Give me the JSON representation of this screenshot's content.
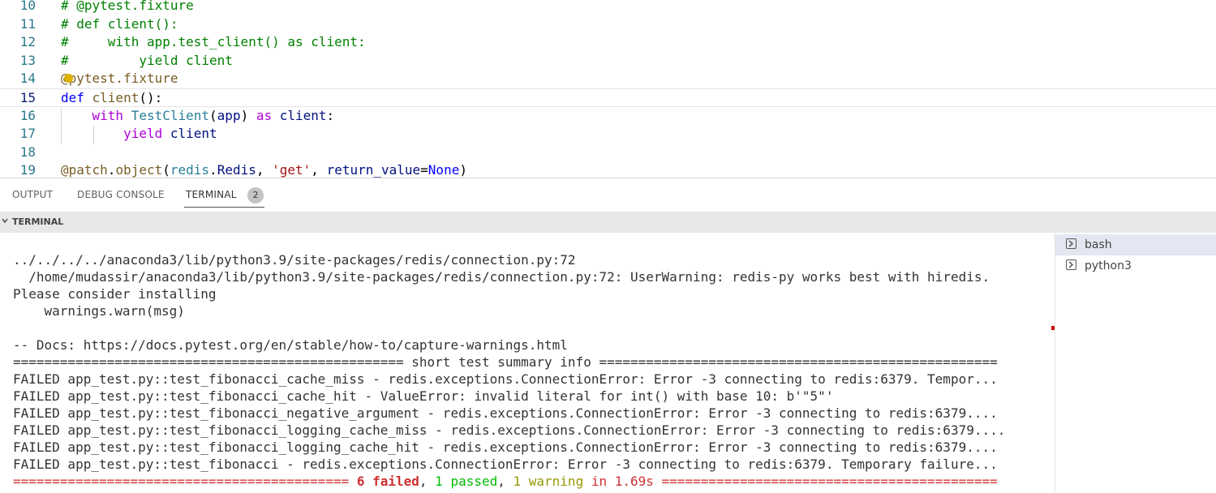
{
  "editor": {
    "lines": [
      {
        "num": "10",
        "tokens": [
          {
            "t": "# @pytest.fixture",
            "c": "cm"
          }
        ]
      },
      {
        "num": "11",
        "tokens": [
          {
            "t": "# def client():",
            "c": "cm"
          }
        ]
      },
      {
        "num": "12",
        "tokens": [
          {
            "t": "#     with app.test_client() as client:",
            "c": "cm"
          }
        ]
      },
      {
        "num": "13",
        "tokens": [
          {
            "t": "#         yield client",
            "c": "cm"
          }
        ]
      },
      {
        "num": "14",
        "tokens": [
          {
            "t": "@pytest.fixture",
            "c": "dec"
          }
        ]
      },
      {
        "num": "15",
        "tokens": [
          {
            "t": "def ",
            "c": "kw"
          },
          {
            "t": "client",
            "c": "fn"
          },
          {
            "t": "():",
            "c": ""
          }
        ]
      },
      {
        "num": "16",
        "tokens": [
          {
            "t": "    ",
            "c": ""
          },
          {
            "t": "with ",
            "c": "ctl"
          },
          {
            "t": "TestClient",
            "c": "cls"
          },
          {
            "t": "(",
            "c": ""
          },
          {
            "t": "app",
            "c": "var"
          },
          {
            "t": ") ",
            "c": ""
          },
          {
            "t": "as ",
            "c": "ctl"
          },
          {
            "t": "client",
            "c": "var"
          },
          {
            "t": ":",
            "c": ""
          }
        ]
      },
      {
        "num": "17",
        "tokens": [
          {
            "t": "        ",
            "c": ""
          },
          {
            "t": "yield ",
            "c": "ctl"
          },
          {
            "t": "client",
            "c": "var"
          }
        ]
      },
      {
        "num": "18",
        "tokens": []
      },
      {
        "num": "19",
        "tokens": [
          {
            "t": "@patch",
            "c": "dec"
          },
          {
            "t": ".",
            "c": ""
          },
          {
            "t": "object",
            "c": "fn"
          },
          {
            "t": "(",
            "c": ""
          },
          {
            "t": "redis",
            "c": "cls"
          },
          {
            "t": ".",
            "c": ""
          },
          {
            "t": "Redis",
            "c": "var"
          },
          {
            "t": ", ",
            "c": ""
          },
          {
            "t": "'get'",
            "c": "str"
          },
          {
            "t": ", ",
            "c": ""
          },
          {
            "t": "return_value",
            "c": "var"
          },
          {
            "t": "=",
            "c": ""
          },
          {
            "t": "None",
            "c": "kw"
          },
          {
            "t": ")",
            "c": ""
          }
        ]
      }
    ]
  },
  "panel": {
    "tabs": [
      {
        "label": "OUTPUT",
        "active": false
      },
      {
        "label": "DEBUG CONSOLE",
        "active": false
      },
      {
        "label": "TERMINAL",
        "active": true
      }
    ],
    "terminal_badge": "2",
    "section_title": "TERMINAL",
    "chevron_icon": "chevron-down-icon"
  },
  "terminal": {
    "lines": [
      [
        {
          "t": "../../../../anaconda3/lib/python3.9/site-packages/redis/connection.py:72",
          "c": ""
        }
      ],
      [
        {
          "t": "  /home/mudassir/anaconda3/lib/python3.9/site-packages/redis/connection.py:72: UserWarning: redis-py works best with hiredis.",
          "c": ""
        }
      ],
      [
        {
          "t": "Please consider installing",
          "c": ""
        }
      ],
      [
        {
          "t": "    warnings.warn(msg)",
          "c": ""
        }
      ],
      [],
      [
        {
          "t": "-- Docs: https://docs.pytest.org/en/stable/how-to/capture-warnings.html",
          "c": ""
        }
      ],
      [
        {
          "t": "================================================== short test summary info ===================================================",
          "c": ""
        }
      ],
      [
        {
          "t": "FAILED app_test.py::test_fibonacci_cache_miss - redis.exceptions.ConnectionError: Error -3 connecting to redis:6379. Tempor...",
          "c": ""
        }
      ],
      [
        {
          "t": "FAILED app_test.py::test_fibonacci_cache_hit - ValueError: invalid literal for int() with base 10: b'\"5\"'",
          "c": ""
        }
      ],
      [
        {
          "t": "FAILED app_test.py::test_fibonacci_negative_argument - redis.exceptions.ConnectionError: Error -3 connecting to redis:6379....",
          "c": ""
        }
      ],
      [
        {
          "t": "FAILED app_test.py::test_fibonacci_logging_cache_miss - redis.exceptions.ConnectionError: Error -3 connecting to redis:6379....",
          "c": ""
        }
      ],
      [
        {
          "t": "FAILED app_test.py::test_fibonacci_logging_cache_hit - redis.exceptions.ConnectionError: Error -3 connecting to redis:6379....",
          "c": ""
        }
      ],
      [
        {
          "t": "FAILED app_test.py::test_fibonacci - redis.exceptions.ConnectionError: Error -3 connecting to redis:6379. Temporary failure...",
          "c": ""
        }
      ],
      [
        {
          "t": "=========================================== ",
          "c": "red"
        },
        {
          "t": "6 failed",
          "c": "red bold"
        },
        {
          "t": ", ",
          "c": ""
        },
        {
          "t": "1 passed",
          "c": "green"
        },
        {
          "t": ", ",
          "c": ""
        },
        {
          "t": "1 warning",
          "c": "yellow"
        },
        {
          "t": " in 1.69s",
          "c": "red"
        },
        {
          "t": " ===========================================",
          "c": "red"
        }
      ]
    ],
    "sessions": [
      {
        "label": "bash",
        "icon": "terminal-icon",
        "selected": true
      },
      {
        "label": "python3",
        "icon": "terminal-icon",
        "selected": false
      }
    ]
  },
  "colors": {
    "comment": "#008000",
    "keyword": "#0000ff",
    "function": "#795e26",
    "variable": "#001080",
    "control": "#af00db",
    "class": "#267f99",
    "string": "#a31515",
    "error": "#cd3131",
    "passed": "#00bc00",
    "warning": "#949800"
  }
}
